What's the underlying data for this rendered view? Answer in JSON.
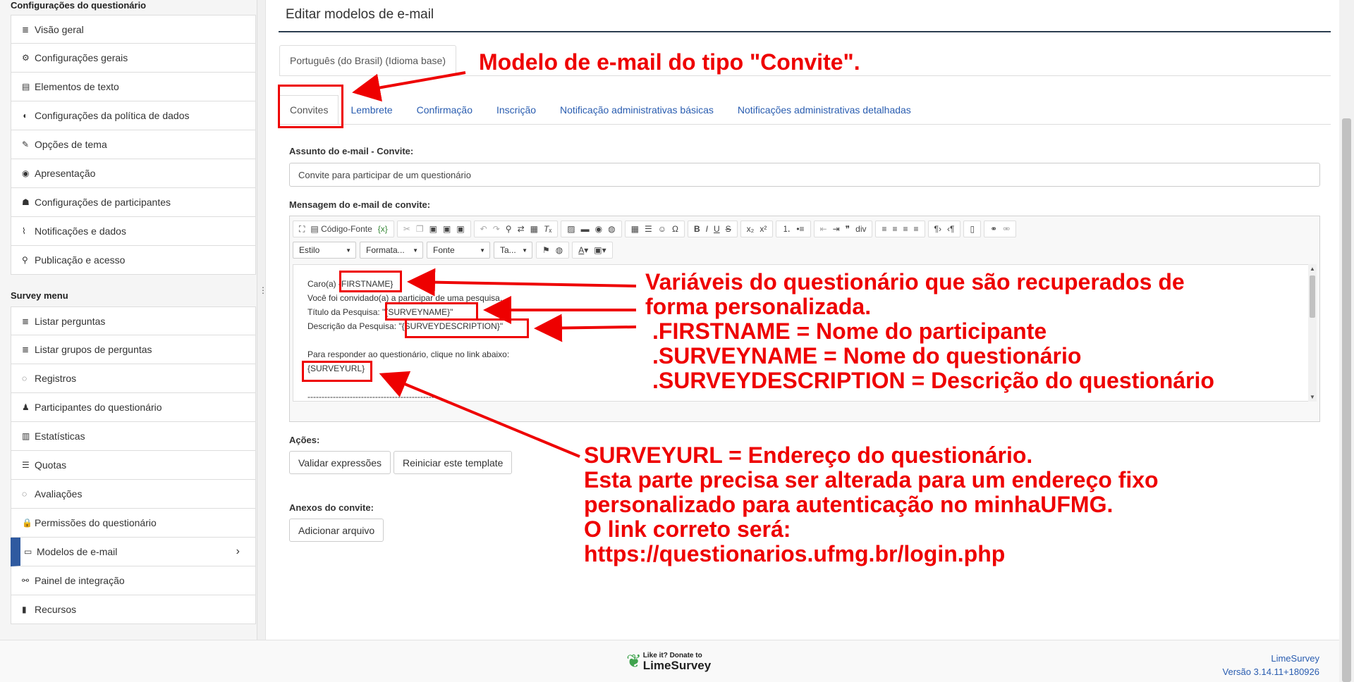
{
  "sidebar": {
    "section1_heading": "Configurações do questionário",
    "section1_items": [
      {
        "icon": "≣",
        "label": "Visão geral"
      },
      {
        "icon": "⚙",
        "label": "Configurações gerais"
      },
      {
        "icon": "▤",
        "label": "Elementos de texto"
      },
      {
        "icon": "◖",
        "label": "Configurações da política de dados"
      },
      {
        "icon": "✎",
        "label": "Opções de tema"
      },
      {
        "icon": "◉",
        "label": "Apresentação"
      },
      {
        "icon": "☗",
        "label": "Configurações de participantes"
      },
      {
        "icon": "⌇",
        "label": "Notificações e dados"
      },
      {
        "icon": "⚲",
        "label": "Publicação e acesso"
      }
    ],
    "section2_heading": "Survey menu",
    "section2_items": [
      {
        "icon": "≣",
        "label": "Listar perguntas"
      },
      {
        "icon": "≣",
        "label": "Listar grupos de perguntas"
      },
      {
        "icon": "◌",
        "label": "Registros"
      },
      {
        "icon": "♟",
        "label": "Participantes do questionário"
      },
      {
        "icon": "▥",
        "label": "Estatísticas"
      },
      {
        "icon": "☰",
        "label": "Quotas"
      },
      {
        "icon": "◌",
        "label": "Avaliações"
      },
      {
        "icon": "🔒",
        "label": "Permissões do questionário"
      },
      {
        "icon": "▭",
        "label": "Modelos de e-mail",
        "active": true
      },
      {
        "icon": "⚯",
        "label": "Painel de integração"
      },
      {
        "icon": "▮",
        "label": "Recursos"
      }
    ]
  },
  "main": {
    "title": "Editar modelos de e-mail",
    "language_tab": "Português (do Brasil) (Idioma base)",
    "tabs": [
      "Convites",
      "Lembrete",
      "Confirmação",
      "Inscrição",
      "Notificação administrativas básicas",
      "Notificações administrativas detalhadas"
    ],
    "subject_label": "Assunto do e-mail - Convite:",
    "subject_value": "Convite para participar de um questionário",
    "message_label": "Mensagem do e-mail de convite:",
    "toolbar": {
      "source_label": "Código-Fonte",
      "style_combo": "Estilo",
      "format_combo": "Formata...",
      "font_combo": "Fonte",
      "size_combo": "Ta..."
    },
    "body_lines": [
      "Caro(a) {FIRSTNAME}",
      "Você foi convidado(a) a participar de uma pesquisa.",
      "Título da Pesquisa: \"{SURVEYNAME}\"",
      "Descrição da Pesquisa: \"{SURVEYDESCRIPTION}\"",
      "",
      "Para responder ao questionário, clique no link abaixo:",
      "{SURVEYURL}",
      "",
      "----------------------------------------------"
    ],
    "actions_label": "Ações:",
    "validate_button": "Validar expressões",
    "reset_button": "Reiniciar este template",
    "attachments_label": "Anexos do convite:",
    "add_file_button": "Adicionar arquivo"
  },
  "annotations": {
    "tab_note": "Modelo de e-mail do tipo \"Convite\".",
    "vars_line1": "Variáveis do questionário que são recuperados de",
    "vars_line2": "forma personalizada.",
    "vars_line3": ".FIRSTNAME = Nome do participante",
    "vars_line4": ".SURVEYNAME = Nome do questionário",
    "vars_line5": ".SURVEYDESCRIPTION = Descrição do questionário",
    "url_line1": "SURVEYURL = Endereço do questionário.",
    "url_line2": "Esta parte precisa ser alterada para um endereço fixo",
    "url_line3": "personalizado para autenticação no minhaUFMG.",
    "url_line4": "O link correto será:",
    "url_line5": "https://questionarios.ufmg.br/login.php",
    "color": "#e00000"
  },
  "footer": {
    "donate_small": "Like it? Donate to",
    "donate_brand": "LimeSurvey",
    "brand": "LimeSurvey",
    "version": "Versão 3.14.11+180926"
  }
}
